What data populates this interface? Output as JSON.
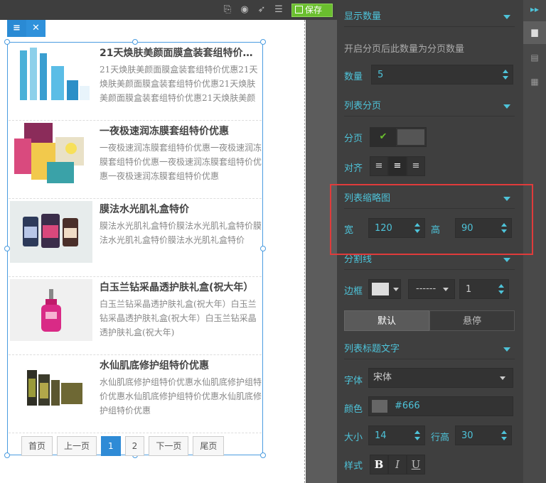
{
  "toolbar": {
    "save_label": "保存"
  },
  "list": [
    {
      "title": "21天焕肤美颜面膜盒装套组特价…",
      "desc": "21天焕肤美颜面膜盒装套组特价优惠21天焕肤美颜面膜盒装套组特价优惠21天焕肤美颜面膜盒装套组特价优惠21天焕肤美颜面膜盒"
    },
    {
      "title": "一夜极速润冻膜套组特价优惠",
      "desc": "一夜极速润冻膜套组特价优惠一夜极速润冻膜套组特价优惠一夜极速润冻膜套组特价优惠一夜极速润冻膜套组特价优惠"
    },
    {
      "title": "膜法水光肌礼盒特价",
      "desc": "膜法水光肌礼盒特价膜法水光肌礼盒特价膜法水光肌礼盒特价膜法水光肌礼盒特价"
    },
    {
      "title": "白玉兰钻采晶透护肤礼盒(祝大年）",
      "desc": "白玉兰钻采晶透护肤礼盒(祝大年）白玉兰钻采晶透护肤礼盒(祝大年）白玉兰钻采晶透护肤礼盒(祝大年)"
    },
    {
      "title": "水仙肌底修护组特价优惠",
      "desc": "水仙肌底修护组特价优惠水仙肌底修护组特价优惠水仙肌底修护组特价优惠水仙肌底修护组特价优惠"
    }
  ],
  "pager": {
    "first": "首页",
    "prev": "上一页",
    "p1": "1",
    "p2": "2",
    "next": "下一页",
    "last": "尾页"
  },
  "panel": {
    "s1": "显示数量",
    "hint": "开启分页后此数量为分页数量",
    "count_label": "数量",
    "count": "5",
    "s2": "列表分页",
    "paging_label": "分页",
    "align_label": "对齐",
    "s3": "列表缩略图",
    "w_label": "宽",
    "w": "120",
    "h_label": "高",
    "h": "90",
    "s4": "分割线",
    "border_label": "边框",
    "border_style": "------",
    "border_w": "1",
    "tab_default": "默认",
    "tab_hover": "悬停",
    "s5": "列表标题文字",
    "font_label": "字体",
    "font": "宋体",
    "color_label": "颜色",
    "color": "#666",
    "size_label": "大小",
    "size": "14",
    "lh_label": "行高",
    "lh": "30",
    "style_label": "样式",
    "b": "B",
    "i": "I",
    "u": "U"
  },
  "colors": {
    "accent": "#4ec3d9",
    "save": "#6abf2e",
    "highlight": "#e03b3b"
  }
}
